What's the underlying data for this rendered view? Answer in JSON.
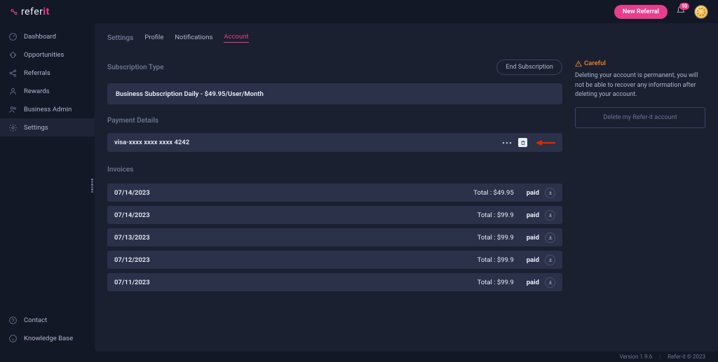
{
  "brand": {
    "name": "refer",
    "accent": "it"
  },
  "header": {
    "new_referral": "New Referral",
    "notif_count": "10"
  },
  "sidebar": {
    "items": [
      {
        "label": "Dashboard"
      },
      {
        "label": "Opportunities"
      },
      {
        "label": "Referrals"
      },
      {
        "label": "Rewards"
      },
      {
        "label": "Business Admin"
      },
      {
        "label": "Settings"
      }
    ],
    "bottom": [
      {
        "label": "Contact"
      },
      {
        "label": "Knowledge Base"
      }
    ]
  },
  "tabs": {
    "heading": "Settings",
    "items": [
      "Profile",
      "Notifications",
      "Account"
    ],
    "active": "Account"
  },
  "subscription": {
    "title": "Subscription Type",
    "end_btn": "End Subscription",
    "plan": "Business Subscription Daily - $49.95/User/Month"
  },
  "payment": {
    "title": "Payment Details",
    "card": "visa-xxxx xxxx xxxx 4242"
  },
  "invoices": {
    "title": "Invoices",
    "total_prefix": "Total : ",
    "rows": [
      {
        "date": "07/14/2023",
        "total": "$49.95",
        "status": "paid"
      },
      {
        "date": "07/14/2023",
        "total": "$99.9",
        "status": "paid"
      },
      {
        "date": "07/13/2023",
        "total": "$99.9",
        "status": "paid"
      },
      {
        "date": "07/12/2023",
        "total": "$99.9",
        "status": "paid"
      },
      {
        "date": "07/11/2023",
        "total": "$99.9",
        "status": "paid"
      }
    ]
  },
  "danger": {
    "careful": "Careful",
    "text": "Deleting your account is permanent, you will not be able to recover any information after deleting your account.",
    "delete_btn": "Delete my Refer-it account"
  },
  "footer": {
    "version": "Version 1.9.6",
    "copyright": "Refer-it © 2023"
  }
}
